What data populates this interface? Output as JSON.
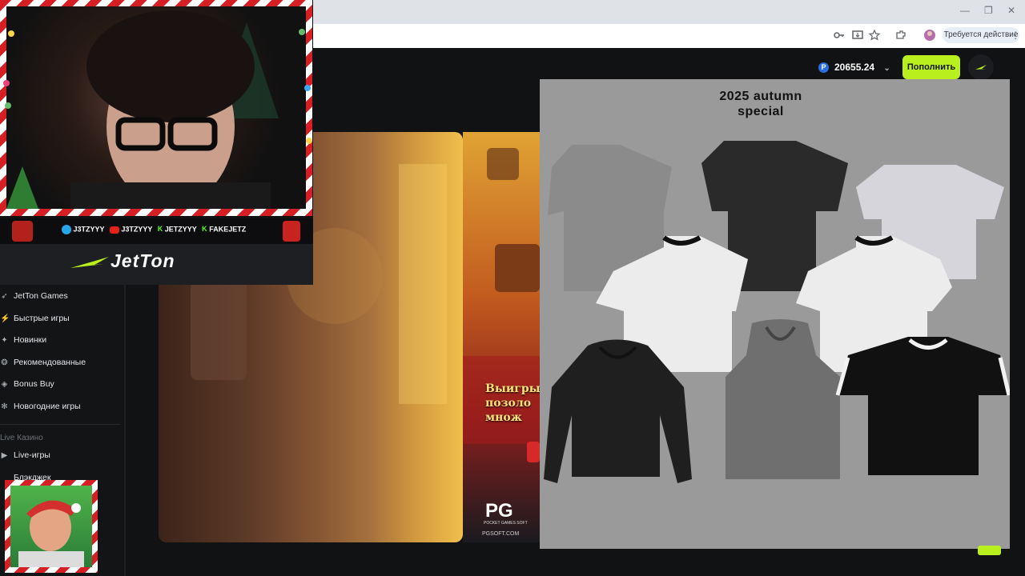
{
  "browser": {
    "action_pill_label": "Требуется действие",
    "window_controls": [
      "—",
      "❐",
      "✕"
    ]
  },
  "header": {
    "balance": "20655.24",
    "currency_icon": "P",
    "deposit_label": "Пополнить"
  },
  "stream": {
    "brand": "JetTon",
    "socials": [
      "J3TZYYY",
      "J3TZYYY",
      "JETZYYY",
      "FAKEJETZ"
    ]
  },
  "sidebar": {
    "items": [
      {
        "icon": "➶",
        "label": "JetTon Games"
      },
      {
        "icon": "⚡",
        "label": "Быстрые игры"
      },
      {
        "icon": "✦",
        "label": "Новинки"
      },
      {
        "icon": "❂",
        "label": "Рекомендованные"
      },
      {
        "icon": "◈",
        "label": "Bonus Buy"
      },
      {
        "icon": "✻",
        "label": "Новогодние игры"
      }
    ],
    "section_label": "Live Казино",
    "live_items": [
      {
        "icon": "▶",
        "label": "Live-игры"
      },
      {
        "icon": "",
        "label": "Блэкджек"
      }
    ]
  },
  "games": {
    "right_card_lines": [
      "Выигры",
      "позоло",
      "множ"
    ],
    "right_card_brand": "PG",
    "right_card_sub": "POCKET GAMES SOFT",
    "right_card_url": "PGSOFT.COM"
  },
  "shop": {
    "title_line1": "2025 autumn",
    "title_line2": "special"
  },
  "colors": {
    "accent": "#b8ef1d",
    "dark": "#111213",
    "shop_bg": "#9a9a9a"
  }
}
